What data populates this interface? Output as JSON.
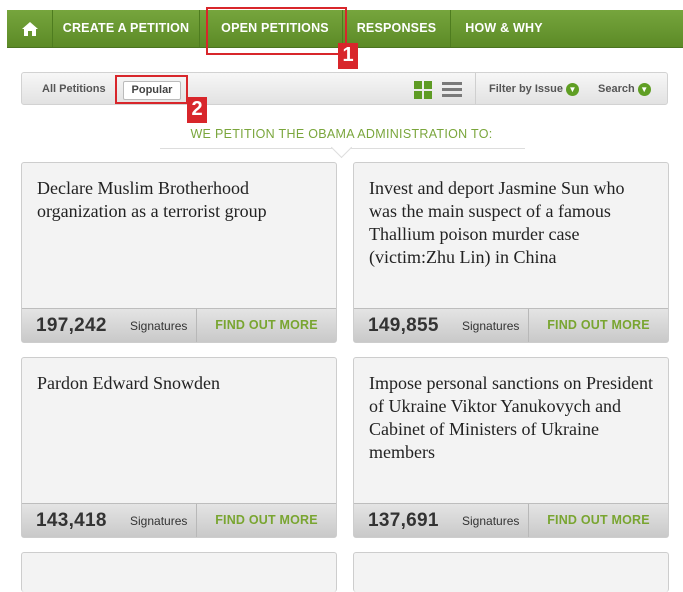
{
  "nav": {
    "home_icon": "home-icon",
    "items": [
      "CREATE A PETITION",
      "OPEN PETITIONS",
      "RESPONSES",
      "HOW & WHY"
    ]
  },
  "filters": {
    "all_label": "All Petitions",
    "popular_label": "Popular",
    "filter_label": "Filter by Issue",
    "search_label": "Search"
  },
  "headline": "WE PETITION THE OBAMA ADMINISTRATION TO:",
  "annotations": [
    "1",
    "2"
  ],
  "petitions": [
    {
      "title": "Declare Muslim Brotherhood organization as a terrorist group",
      "count": "197,242",
      "sig_label": "Signatures",
      "cta": "FIND OUT MORE"
    },
    {
      "title": "Invest and deport Jasmine Sun who was the main suspect of a famous Thallium poison murder case (victim:Zhu Lin) in China",
      "count": "149,855",
      "sig_label": "Signatures",
      "cta": "FIND OUT MORE"
    },
    {
      "title": "Pardon Edward Snowden",
      "count": "143,418",
      "sig_label": "Signatures",
      "cta": "FIND OUT MORE"
    },
    {
      "title": "Impose personal sanctions on President of Ukraine Viktor Yanukovych and Cabinet of Ministers of Ukraine members",
      "count": "137,691",
      "sig_label": "Signatures",
      "cta": "FIND OUT MORE"
    }
  ],
  "colors": {
    "nav_green": "#6a9a32",
    "accent_green": "#79a531",
    "annotation_red": "#d8262b"
  }
}
